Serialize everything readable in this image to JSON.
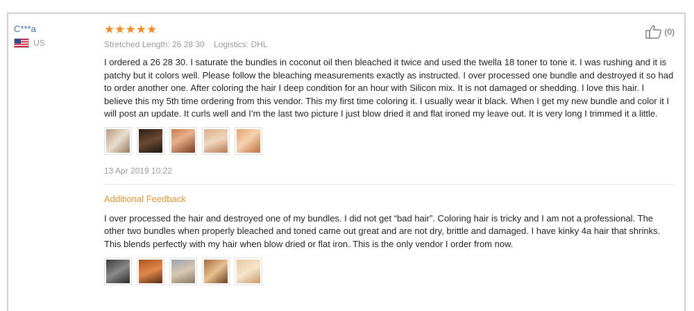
{
  "review": {
    "user_name": "C***a",
    "country": "US",
    "rating": "★★★★★",
    "stretched_length": "Stretched Length: 26 28 30",
    "logistics": "Logistics: DHL",
    "text": "I ordered a 26 28 30. I saturate the bundles in coconut oil then bleached it twice and used the twella 18 toner to tone it. I was rushing and it is patchy but it colors well. Please follow the bleaching measurements exactly as instructed. I over processed one bundle and destroyed it so had to order another one. After coloring the hair I deep condition for an hour with Silicon mix. It is not damaged or shedding. I love this hair. I believe this my 5th time ordering from this vendor. This my first time coloring it. I usually wear it black. When I get my new bundle and color it I will post an update. It curls well and I’m the last two picture I just blow dried it and flat ironed my leave out. It is very long I trimmed it a little.",
    "date": "13 Apr 2019 10:22",
    "helpful_count": "(0)",
    "additional_feedback_title": "Additional Feedback",
    "additional_feedback_text": "I over processed the hair and destroyed one of my bundles. I did not get “bad hair”. Coloring hair is tricky and I am not a professional. The other two bundles when properly bleached and toned came out great and are not dry, brittle and damaged. I have kinky 4a hair that shrinks. This blends perfectly with my hair when blow dried or flat iron. This is the only vendor I order from now."
  },
  "colors": {
    "star": "#f58a1f",
    "user_link": "#3b6fb6",
    "additional_title": "#e8912d"
  }
}
